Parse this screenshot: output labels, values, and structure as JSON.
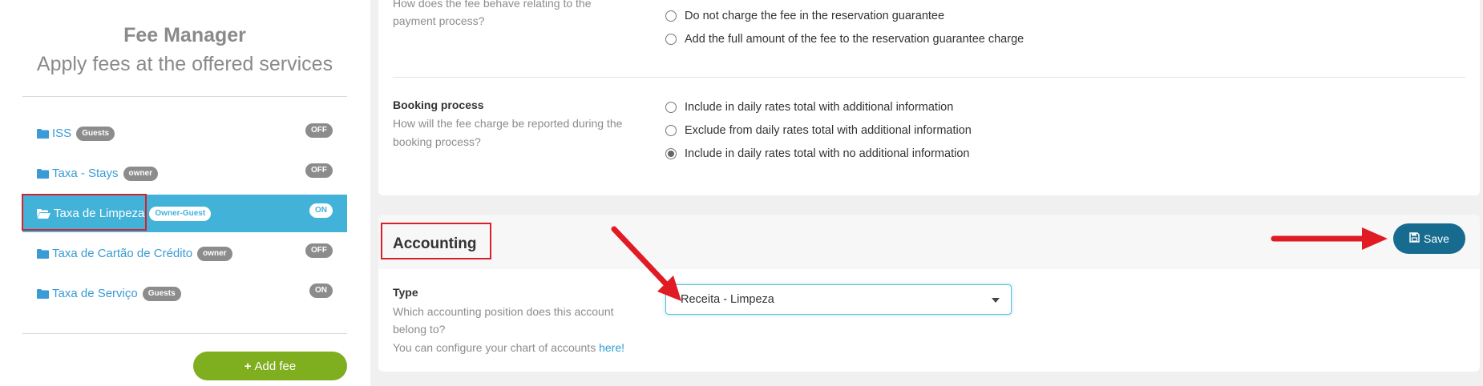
{
  "sidebar": {
    "title": "Fee Manager",
    "subtitle": "Apply fees at the offered services",
    "fees": [
      {
        "name": "ISS",
        "tag": "Guests",
        "status": "OFF",
        "active": false
      },
      {
        "name": "Taxa - Stays",
        "tag": "owner",
        "status": "OFF",
        "active": false
      },
      {
        "name": "Taxa de Limpeza",
        "tag": "Owner-Guest",
        "status": "ON",
        "active": true
      },
      {
        "name": "Taxa de Cartão de Crédito",
        "tag": "owner",
        "status": "OFF",
        "active": false
      },
      {
        "name": "Taxa de Serviço",
        "tag": "Guests",
        "status": "ON",
        "active": false
      }
    ],
    "add_fee_label": "Add fee"
  },
  "payment": {
    "question_line1": "How does the fee behave relating to the",
    "question_line2": "payment process?",
    "options": [
      "Do not charge the fee in the reservation guarantee",
      "Add the full amount of the fee to the reservation guarantee charge"
    ]
  },
  "booking": {
    "title": "Booking process",
    "question_line1": "How will the fee charge be reported during the",
    "question_line2": "booking process?",
    "options": [
      "Include in daily rates total with additional information",
      "Exclude from daily rates total with additional information",
      "Include in daily rates total with no additional information"
    ],
    "selected_index": 2
  },
  "accounting": {
    "title": "Accounting",
    "save_label": "Save",
    "type_label": "Type",
    "question_line1": "Which accounting position does this account",
    "question_line2": "belong to?",
    "configure_text": "You can configure your chart of accounts",
    "configure_link": "here",
    "configure_suffix": "!",
    "selected_value": "Receita - Limpeza"
  },
  "colors": {
    "accent": "#42b2d9",
    "save": "#166b8f",
    "add": "#7fae1f",
    "annotation": "#d6202a"
  }
}
